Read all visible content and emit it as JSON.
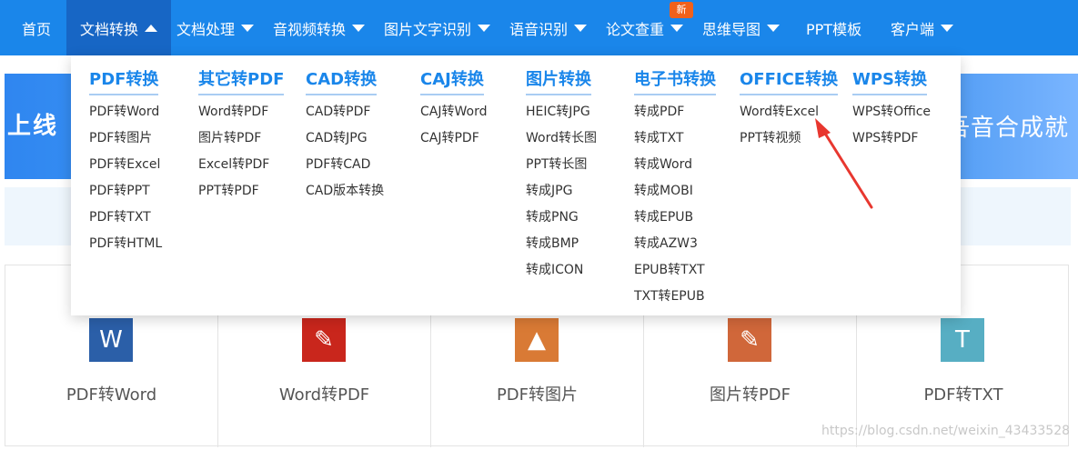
{
  "nav": {
    "items": [
      {
        "label": "首页",
        "has_caret": false
      },
      {
        "label": "文档转换",
        "has_caret": true,
        "active": true
      },
      {
        "label": "文档处理",
        "has_caret": true
      },
      {
        "label": "音视频转换",
        "has_caret": true
      },
      {
        "label": "图片文字识别",
        "has_caret": true
      },
      {
        "label": "语音识别",
        "has_caret": true
      },
      {
        "label": "论文查重",
        "has_caret": true
      },
      {
        "label": "思维导图",
        "has_caret": true
      },
      {
        "label": "PPT模板",
        "has_caret": false
      },
      {
        "label": "客户端",
        "has_caret": true
      }
    ],
    "new_badge": "新"
  },
  "banner": {
    "left_text": "上线",
    "right_text": "吾音合成就"
  },
  "dropdown": {
    "columns": [
      {
        "title": "PDF转换",
        "items": [
          "PDF转Word",
          "PDF转图片",
          "PDF转Excel",
          "PDF转PPT",
          "PDF转TXT",
          "PDF转HTML"
        ]
      },
      {
        "title": "其它转PDF",
        "items": [
          "Word转PDF",
          "图片转PDF",
          "Excel转PDF",
          "PPT转PDF"
        ]
      },
      {
        "title": "CAD转换",
        "items": [
          "CAD转PDF",
          "CAD转JPG",
          "PDF转CAD",
          "CAD版本转换"
        ]
      },
      {
        "title": "CAJ转换",
        "items": [
          "CAJ转Word",
          "CAJ转PDF"
        ]
      },
      {
        "title": "图片转换",
        "items": [
          "HEIC转JPG",
          "Word转长图",
          "PPT转长图",
          "转成JPG",
          "转成PNG",
          "转成BMP",
          "转成ICON"
        ]
      },
      {
        "title": "电子书转换",
        "items": [
          "转成PDF",
          "转成TXT",
          "转成Word",
          "转成MOBI",
          "转成EPUB",
          "转成AZW3",
          "EPUB转TXT",
          "TXT转EPUB"
        ]
      },
      {
        "title": "OFFICE转换",
        "items": [
          "Word转Excel",
          "PPT转视频"
        ]
      },
      {
        "title": "WPS转换",
        "items": [
          "WPS转Office",
          "WPS转PDF"
        ]
      }
    ]
  },
  "tools": [
    {
      "label": "PDF转Word",
      "icon": "word-icon",
      "glyph": "W",
      "color": "#2b5fa8"
    },
    {
      "label": "Word转PDF",
      "icon": "pdf-icon",
      "glyph": "✎",
      "color": "#c9261c"
    },
    {
      "label": "PDF转图片",
      "icon": "image-icon",
      "glyph": "▲",
      "color": "#d97a35"
    },
    {
      "label": "图片转PDF",
      "icon": "pdf-icon",
      "glyph": "✎",
      "color": "#d0673a"
    },
    {
      "label": "PDF转TXT",
      "icon": "text-icon",
      "glyph": "T",
      "color": "#57aec3"
    }
  ],
  "watermark": "https://blog.csdn.net/weixin_43433528",
  "colors": {
    "nav_bg": "#1a86ea",
    "nav_active": "#1766c5",
    "accent": "#1a86ea",
    "arrow": "#e8372f"
  }
}
